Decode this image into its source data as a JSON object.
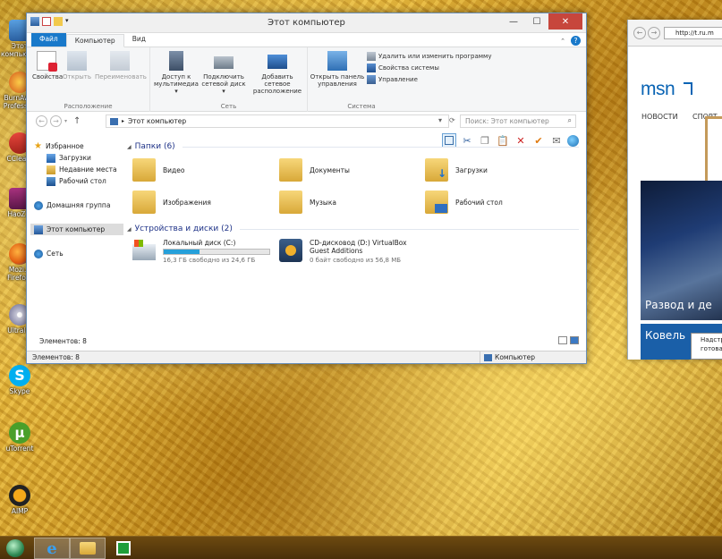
{
  "desktop": {
    "icons": [
      {
        "name": "icon-1",
        "label": "Этот компьют..."
      },
      {
        "name": "icon-burnaware",
        "label": "BurnAw... Professi..."
      },
      {
        "name": "icon-ccleaner",
        "label": "CClea..."
      },
      {
        "name": "icon-haozip",
        "label": "HaoZ..."
      },
      {
        "name": "icon-firefox",
        "label": "Mozi... Firefo..."
      },
      {
        "name": "icon-ultraiso",
        "label": "Ultral..."
      },
      {
        "name": "icon-skype",
        "label": "Skype"
      },
      {
        "name": "icon-utorrent",
        "label": "uTorrent"
      },
      {
        "name": "icon-aimp",
        "label": "AIMP"
      }
    ]
  },
  "explorer": {
    "title": "Этот компьютер",
    "tabs": {
      "file": "Файл",
      "computer": "Компьютер",
      "view": "Вид"
    },
    "ribbon": {
      "location": {
        "name": "Расположение",
        "properties": "Свойства",
        "open": "Открыть",
        "rename": "Переименовать"
      },
      "network": {
        "name": "Сеть",
        "media": "Доступ к мультимедиа ▾",
        "map_drive": "Подключить сетевой диск ▾",
        "add_location": "Добавить сетевое расположение"
      },
      "system": {
        "name": "Система",
        "control_panel": "Открыть панель управления",
        "uninstall": "Удалить или изменить программу",
        "system_props": "Свойства системы",
        "manage": "Управление"
      }
    },
    "address": "Этот компьютер",
    "search_placeholder": "Поиск: Этот компьютер",
    "nav_pane": {
      "favorites": "Избранное",
      "downloads": "Загрузки",
      "recent": "Недавние места",
      "desktop": "Рабочий стол",
      "homegroup": "Домашняя группа",
      "this_pc": "Этот компьютер",
      "network": "Сеть"
    },
    "folders_header": "Папки (6)",
    "folders": [
      "Видео",
      "Документы",
      "Загрузки",
      "Изображения",
      "Музыка",
      "Рабочий стол"
    ],
    "devices_header": "Устройства и диски (2)",
    "drives": [
      {
        "name": "Локальный диск (C:)",
        "free": "16,3 ГБ свободно из 24,6 ГБ",
        "used_fraction": 0.34
      },
      {
        "name": "CD-дисковод (D:) VirtualBox Guest Additions",
        "free": "0 байт свободно из 56,8 МБ"
      }
    ],
    "items_count": "Элементов: 8",
    "status_left": "Элементов: 8",
    "status_right": "Компьютер"
  },
  "browser": {
    "address": "http://t.ru.m",
    "brand": "msn",
    "nav1": "НОВОСТИ",
    "nav2": "СПОРТ",
    "headline": "Развод и де",
    "city": "Ковель",
    "popup_line1": "Надстр",
    "popup_line2": "готова"
  },
  "colors": {
    "accent": "#1979ca",
    "header_blue": "#1e3287",
    "close_red": "#c7463c"
  }
}
